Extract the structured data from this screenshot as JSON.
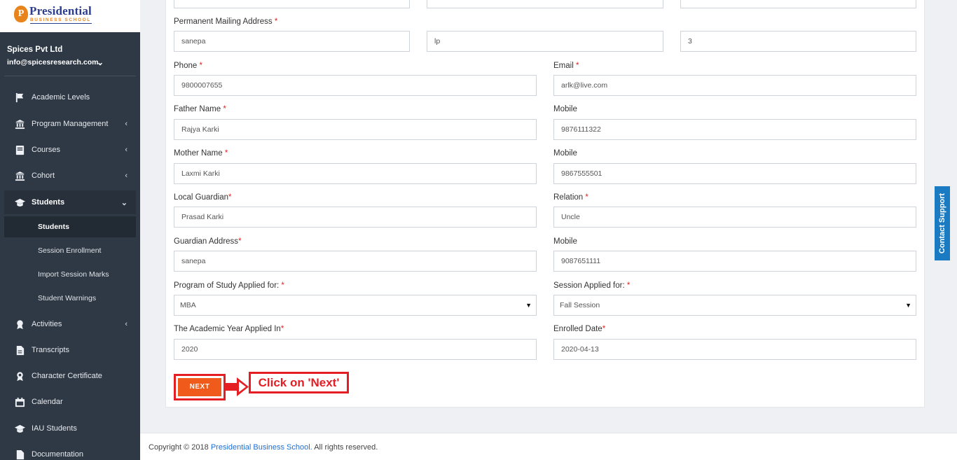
{
  "brand": {
    "logo_letter": "P",
    "title": "Presidential",
    "subtitle": "BUSINESS SCHOOL"
  },
  "account": {
    "org": "Spices Pvt Ltd",
    "email": "info@spicesresearch.com",
    "chevron": "⌄"
  },
  "nav": {
    "academic_levels": "Academic Levels",
    "program_management": "Program Management",
    "courses": "Courses",
    "cohort": "Cohort",
    "students": "Students",
    "students_sub": [
      "Students",
      "Session Enrollment",
      "Import Session Marks",
      "Student Warnings"
    ],
    "activities": "Activities",
    "transcripts": "Transcripts",
    "character_certificate": "Character Certificate",
    "calendar": "Calendar",
    "iau_students": "IAU Students",
    "documentation": "Documentation",
    "collapsed_arrow": "‹",
    "expanded_arrow": "⌄"
  },
  "form": {
    "permanent_address_label": "Permanent Mailing Address",
    "permanent_address": [
      "sanepa",
      "lp",
      "3"
    ],
    "phone_label": "Phone",
    "phone": "9800007655",
    "email_label": "Email",
    "email": "arlk@live.com",
    "father_label": "Father Name",
    "father": "Rajya Karki",
    "father_mobile_label": "Mobile",
    "father_mobile": "9876111322",
    "mother_label": "Mother Name",
    "mother": "Laxmi Karki",
    "mother_mobile_label": "Mobile",
    "mother_mobile": "9867555501",
    "guardian_label": "Local Guardian",
    "guardian": "Prasad Karki",
    "relation_label": "Relation",
    "relation": "Uncle",
    "guardian_address_label": "Guardian Address",
    "guardian_address": "sanepa",
    "guardian_mobile_label": "Mobile",
    "guardian_mobile": "9087651111",
    "program_label": "Program of Study Applied for:",
    "program": "MBA",
    "session_label": "Session Applied for:",
    "session": "Fall Session",
    "year_label": "The Academic Year Applied In",
    "year": "2020",
    "enrolled_label": "Enrolled Date",
    "enrolled": "2020-04-13",
    "required_mark": "*",
    "caret": "▼"
  },
  "next_button": "NEXT",
  "callout": "Click on 'Next'",
  "footer": {
    "prefix": "Copyright © 2018 ",
    "link": "Presidential Business School.",
    "suffix": " All rights reserved."
  },
  "contact_support": "Contact Support",
  "colors": {
    "sidebar": "#2f3945",
    "accent": "#f05a1a",
    "annotation": "#e51e24",
    "link": "#1d6fd1",
    "contact": "#1a7ac2"
  }
}
